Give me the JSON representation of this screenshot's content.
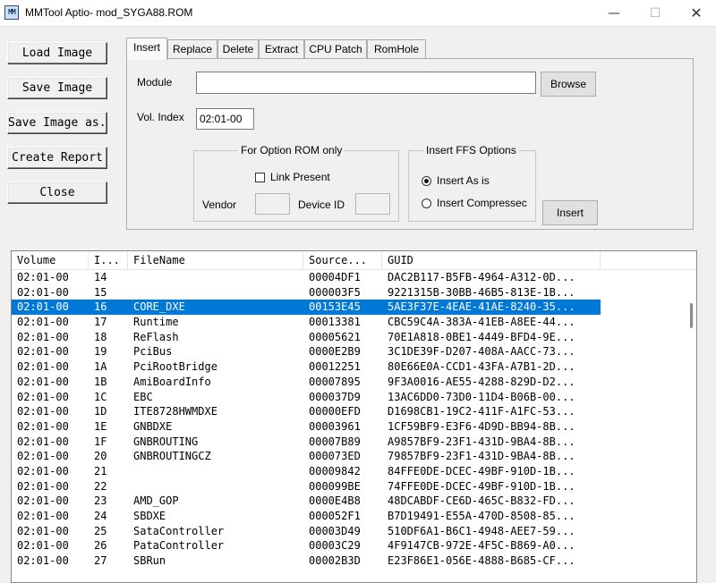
{
  "window": {
    "title": "MMTool Aptio- mod_SYGA88.ROM",
    "icon_text": "MM",
    "minimize": "—",
    "maximize": "☐",
    "close": "✕"
  },
  "left_buttons": {
    "load": "Load Image",
    "save": "Save Image",
    "save_as": "Save Image as..",
    "report": "Create Report",
    "close": "Close"
  },
  "tabs": [
    "Insert",
    "Replace",
    "Delete",
    "Extract",
    "CPU Patch",
    "RomHole"
  ],
  "insert": {
    "module_label": "Module",
    "module_value": "",
    "browse": "Browse",
    "vol_index_label": "Vol. Index",
    "vol_index_value": "02:01-00",
    "option_rom_group": "For Option ROM only",
    "link_present": "Link Present",
    "vendor_label": "Vendor",
    "device_id_label": "Device ID",
    "ffs_group": "Insert FFS Options",
    "insert_as_is": "Insert As is",
    "insert_compressed": "Insert Compressec",
    "insert_button": "Insert"
  },
  "list": {
    "columns": [
      "Volume",
      "I...",
      "FileName",
      "Source...",
      "GUID"
    ],
    "selected_index": 2,
    "rows": [
      [
        "02:01-00",
        "14",
        "",
        "00004DF1",
        "DAC2B117-B5FB-4964-A312-0D..."
      ],
      [
        "02:01-00",
        "15",
        "",
        "000003F5",
        "9221315B-30BB-46B5-813E-1B..."
      ],
      [
        "02:01-00",
        "16",
        "CORE_DXE",
        "00153E45",
        "5AE3F37E-4EAE-41AE-8240-35..."
      ],
      [
        "02:01-00",
        "17",
        "Runtime",
        "00013381",
        "CBC59C4A-383A-41EB-A8EE-44..."
      ],
      [
        "02:01-00",
        "18",
        "ReFlash",
        "00005621",
        "70E1A818-0BE1-4449-BFD4-9E..."
      ],
      [
        "02:01-00",
        "19",
        "PciBus",
        "0000E2B9",
        "3C1DE39F-D207-408A-AACC-73..."
      ],
      [
        "02:01-00",
        "1A",
        "PciRootBridge",
        "00012251",
        "80E66E0A-CCD1-43FA-A7B1-2D..."
      ],
      [
        "02:01-00",
        "1B",
        "AmiBoardInfo",
        "00007895",
        "9F3A0016-AE55-4288-829D-D2..."
      ],
      [
        "02:01-00",
        "1C",
        "EBC",
        "000037D9",
        "13AC6DD0-73D0-11D4-B06B-00..."
      ],
      [
        "02:01-00",
        "1D",
        "ITE8728HWMDXE",
        "00000EFD",
        "D1698CB1-19C2-411F-A1FC-53..."
      ],
      [
        "02:01-00",
        "1E",
        "GNBDXE",
        "00003961",
        "1CF59BF9-E3F6-4D9D-BB94-8B..."
      ],
      [
        "02:01-00",
        "1F",
        "GNBROUTING",
        "00007B89",
        "A9857BF9-23F1-431D-9BA4-8B..."
      ],
      [
        "02:01-00",
        "20",
        "GNBROUTINGCZ",
        "000073ED",
        "79857BF9-23F1-431D-9BA4-8B..."
      ],
      [
        "02:01-00",
        "21",
        "",
        "00009842",
        "84FFE0DE-DCEC-49BF-910D-1B..."
      ],
      [
        "02:01-00",
        "22",
        "",
        "000099BE",
        "74FFE0DE-DCEC-49BF-910D-1B..."
      ],
      [
        "02:01-00",
        "23",
        "AMD_GOP",
        "0000E4B8",
        "48DCABDF-CE6D-465C-B832-FD..."
      ],
      [
        "02:01-00",
        "24",
        "SBDXE",
        "000052F1",
        "B7D19491-E55A-470D-8508-85..."
      ],
      [
        "02:01-00",
        "25",
        "SataController",
        "00003D49",
        "510DF6A1-B6C1-4948-AEE7-59..."
      ],
      [
        "02:01-00",
        "26",
        "PataController",
        "00003C29",
        "4F9147CB-972E-4F5C-B869-A0..."
      ],
      [
        "02:01-00",
        "27",
        "SBRun",
        "00002B3D",
        "E23F86E1-056E-4888-B685-CF..."
      ]
    ]
  }
}
